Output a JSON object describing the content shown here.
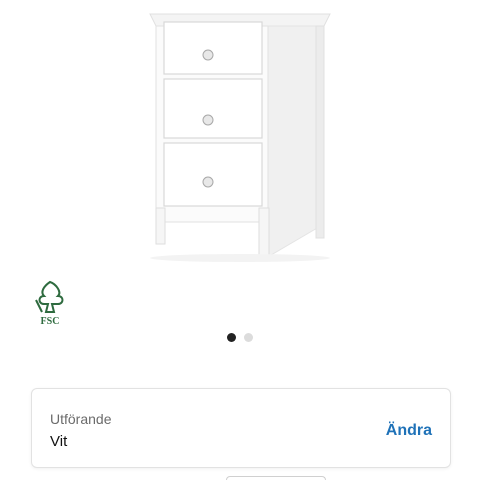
{
  "product": {
    "image_icon": "white-three-drawer-nightstand",
    "certification_icon": "fsc-tree-logo",
    "certification_text": "FSC"
  },
  "carousel": {
    "total": 2,
    "active_index": 0
  },
  "variant": {
    "label": "Utförande",
    "value": "Vit",
    "change_label": "Ändra"
  },
  "colors": {
    "link": "#1f72b8",
    "fsc_green": "#2e6b3f",
    "dot_active": "#222222",
    "dot_inactive": "#dcdcdc"
  }
}
